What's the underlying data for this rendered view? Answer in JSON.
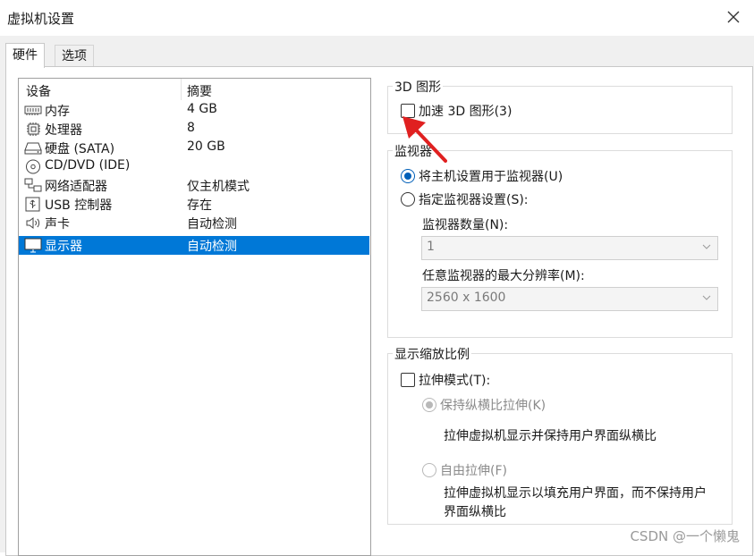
{
  "window": {
    "title": "虚拟机设置"
  },
  "tabs": [
    {
      "label": "硬件",
      "active": true
    },
    {
      "label": "选项",
      "active": false
    }
  ],
  "device_table": {
    "headers": {
      "device": "设备",
      "summary": "摘要"
    },
    "rows": [
      {
        "icon": "memory-icon",
        "name": "内存",
        "summary": "4 GB"
      },
      {
        "icon": "processor-icon",
        "name": "处理器",
        "summary": "8"
      },
      {
        "icon": "hard-disk-icon",
        "name": "硬盘 (SATA)",
        "summary": "20 GB"
      },
      {
        "icon": "cd-dvd-icon",
        "name": "CD/DVD (IDE)",
        "summary": ""
      },
      {
        "icon": "network-adapter-icon",
        "name": "网络适配器",
        "summary": "仅主机模式"
      },
      {
        "icon": "usb-icon",
        "name": "USB 控制器",
        "summary": "存在"
      },
      {
        "icon": "sound-card-icon",
        "name": "声卡",
        "summary": "自动检测"
      },
      {
        "icon": "display-icon",
        "name": "显示器",
        "summary": "自动检测",
        "selected": true
      }
    ]
  },
  "graphics_3d": {
    "group_label": "3D 图形",
    "accelerate_label": "加速 3D 图形(3)",
    "accelerate_checked": false
  },
  "monitors": {
    "group_label": "监视器",
    "use_host_label": "将主机设置用于监视器(U)",
    "specify_label": "指定监视器设置(S):",
    "selected_option": "use_host",
    "count_label": "监视器数量(N):",
    "count_value": "1",
    "max_resolution_label": "任意监视器的最大分辨率(M):",
    "max_resolution_value": "2560 x 1600"
  },
  "scaling": {
    "group_label": "显示缩放比例",
    "stretch_label": "拉伸模式(T):",
    "stretch_checked": false,
    "keep_aspect_label": "保持纵横比拉伸(K)",
    "keep_aspect_desc": "拉伸虚拟机显示并保持用户界面纵横比",
    "free_stretch_label": "自由拉伸(F)",
    "free_stretch_desc": "拉伸虚拟机显示以填充用户界面，而不保持用户界面纵横比",
    "selected_option": "keep_aspect"
  },
  "watermark": "CSDN @一个懒鬼",
  "colors": {
    "selection": "#0078d7",
    "radio_accent": "#005fb8",
    "annotation_arrow": "#e02020"
  }
}
